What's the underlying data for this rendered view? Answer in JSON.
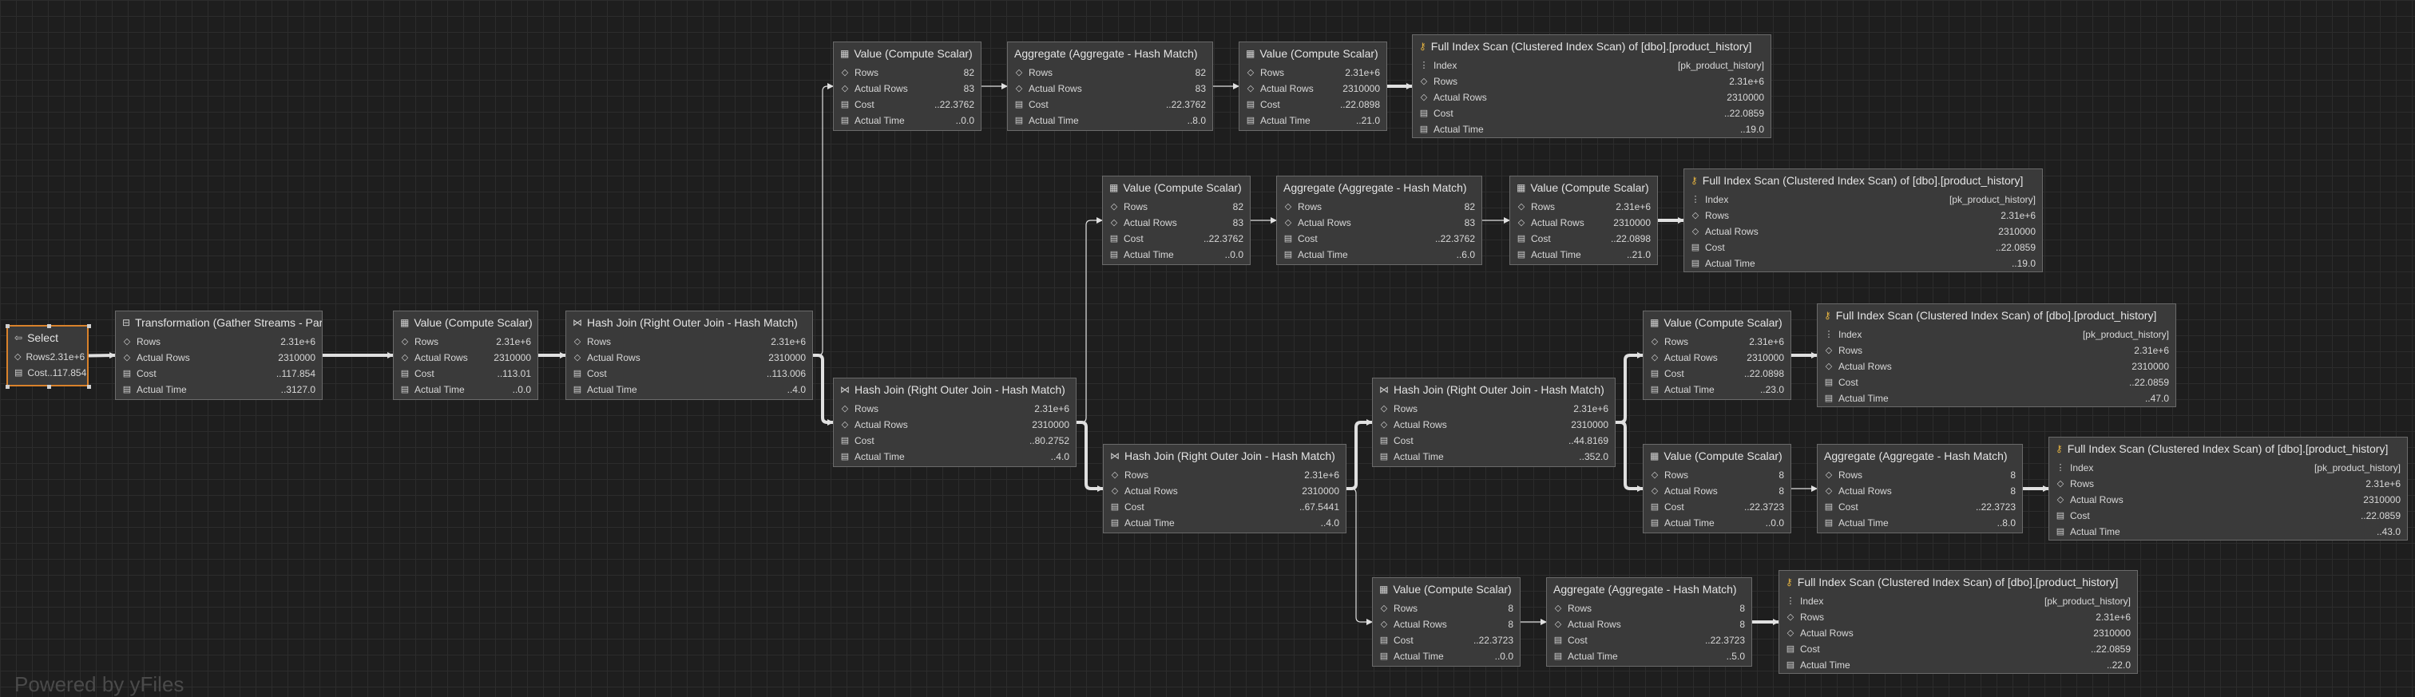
{
  "watermark": "Powered by yFiles",
  "nodes": [
    {
      "id": "select",
      "title": "Select",
      "icon": "select-icon",
      "rows": [
        {
          "icon": "rows-icon",
          "label": "Rows",
          "value": "2.31e+6"
        },
        {
          "icon": "cost-icon",
          "label": "Cost",
          "value": "..117.854"
        }
      ]
    },
    {
      "id": "gather",
      "title": "Transformation (Gather Streams - Parallelism)",
      "icon": "transform-icon",
      "rows": [
        {
          "icon": "rows-icon",
          "label": "Rows",
          "value": "2.31e+6"
        },
        {
          "icon": "actual-rows-icon",
          "label": "Actual Rows",
          "value": "2310000"
        },
        {
          "icon": "cost-icon",
          "label": "Cost",
          "value": "..117.854"
        },
        {
          "icon": "time-icon",
          "label": "Actual Time",
          "value": "..3127.0"
        }
      ]
    },
    {
      "id": "cs1",
      "title": "Value (Compute Scalar)",
      "icon": "table-icon",
      "rows": [
        {
          "icon": "rows-icon",
          "label": "Rows",
          "value": "2.31e+6"
        },
        {
          "icon": "actual-rows-icon",
          "label": "Actual Rows",
          "value": "2310000"
        },
        {
          "icon": "cost-icon",
          "label": "Cost",
          "value": "..113.01"
        },
        {
          "icon": "time-icon",
          "label": "Actual Time",
          "value": "..0.0"
        }
      ]
    },
    {
      "id": "hj1",
      "title": "Hash Join (Right Outer Join - Hash Match)",
      "icon": "join-icon",
      "rows": [
        {
          "icon": "rows-icon",
          "label": "Rows",
          "value": "2.31e+6"
        },
        {
          "icon": "actual-rows-icon",
          "label": "Actual Rows",
          "value": "2310000"
        },
        {
          "icon": "cost-icon",
          "label": "Cost",
          "value": "..113.006"
        },
        {
          "icon": "time-icon",
          "label": "Actual Time",
          "value": "..4.0"
        }
      ]
    },
    {
      "id": "cs_a1",
      "title": "Value (Compute Scalar)",
      "icon": "table-icon",
      "rows": [
        {
          "icon": "rows-icon",
          "label": "Rows",
          "value": "82"
        },
        {
          "icon": "actual-rows-icon",
          "label": "Actual Rows",
          "value": "83"
        },
        {
          "icon": "cost-icon",
          "label": "Cost",
          "value": "..22.3762"
        },
        {
          "icon": "time-icon",
          "label": "Actual Time",
          "value": "..0.0"
        }
      ]
    },
    {
      "id": "agg_a",
      "title": "Aggregate (Aggregate - Hash Match)",
      "icon": "none",
      "rows": [
        {
          "icon": "rows-icon",
          "label": "Rows",
          "value": "82"
        },
        {
          "icon": "actual-rows-icon",
          "label": "Actual Rows",
          "value": "83"
        },
        {
          "icon": "cost-icon",
          "label": "Cost",
          "value": "..22.3762"
        },
        {
          "icon": "time-icon",
          "label": "Actual Time",
          "value": "..8.0"
        }
      ]
    },
    {
      "id": "cs_a2",
      "title": "Value (Compute Scalar)",
      "icon": "table-icon",
      "rows": [
        {
          "icon": "rows-icon",
          "label": "Rows",
          "value": "2.31e+6"
        },
        {
          "icon": "actual-rows-icon",
          "label": "Actual Rows",
          "value": "2310000"
        },
        {
          "icon": "cost-icon",
          "label": "Cost",
          "value": "..22.0898"
        },
        {
          "icon": "time-icon",
          "label": "Actual Time",
          "value": "..21.0"
        }
      ]
    },
    {
      "id": "scan_a",
      "title": "Full Index Scan (Clustered Index Scan) of [dbo].[product_history]",
      "icon": "key-icon",
      "rows": [
        {
          "icon": "index-icon",
          "label": "Index",
          "value": "[pk_product_history]"
        },
        {
          "icon": "rows-icon",
          "label": "Rows",
          "value": "2.31e+6"
        },
        {
          "icon": "actual-rows-icon",
          "label": "Actual Rows",
          "value": "2310000"
        },
        {
          "icon": "cost-icon",
          "label": "Cost",
          "value": "..22.0859"
        },
        {
          "icon": "time-icon",
          "label": "Actual Time",
          "value": "..19.0"
        }
      ]
    },
    {
      "id": "cs_b1",
      "title": "Value (Compute Scalar)",
      "icon": "table-icon",
      "rows": [
        {
          "icon": "rows-icon",
          "label": "Rows",
          "value": "82"
        },
        {
          "icon": "actual-rows-icon",
          "label": "Actual Rows",
          "value": "83"
        },
        {
          "icon": "cost-icon",
          "label": "Cost",
          "value": "..22.3762"
        },
        {
          "icon": "time-icon",
          "label": "Actual Time",
          "value": "..0.0"
        }
      ]
    },
    {
      "id": "agg_b",
      "title": "Aggregate (Aggregate - Hash Match)",
      "icon": "none",
      "rows": [
        {
          "icon": "rows-icon",
          "label": "Rows",
          "value": "82"
        },
        {
          "icon": "actual-rows-icon",
          "label": "Actual Rows",
          "value": "83"
        },
        {
          "icon": "cost-icon",
          "label": "Cost",
          "value": "..22.3762"
        },
        {
          "icon": "time-icon",
          "label": "Actual Time",
          "value": "..6.0"
        }
      ]
    },
    {
      "id": "cs_b2",
      "title": "Value (Compute Scalar)",
      "icon": "table-icon",
      "rows": [
        {
          "icon": "rows-icon",
          "label": "Rows",
          "value": "2.31e+6"
        },
        {
          "icon": "actual-rows-icon",
          "label": "Actual Rows",
          "value": "2310000"
        },
        {
          "icon": "cost-icon",
          "label": "Cost",
          "value": "..22.0898"
        },
        {
          "icon": "time-icon",
          "label": "Actual Time",
          "value": "..21.0"
        }
      ]
    },
    {
      "id": "scan_b",
      "title": "Full Index Scan (Clustered Index Scan) of [dbo].[product_history]",
      "icon": "key-icon",
      "rows": [
        {
          "icon": "index-icon",
          "label": "Index",
          "value": "[pk_product_history]"
        },
        {
          "icon": "rows-icon",
          "label": "Rows",
          "value": "2.31e+6"
        },
        {
          "icon": "actual-rows-icon",
          "label": "Actual Rows",
          "value": "2310000"
        },
        {
          "icon": "cost-icon",
          "label": "Cost",
          "value": "..22.0859"
        },
        {
          "icon": "time-icon",
          "label": "Actual Time",
          "value": "..19.0"
        }
      ]
    },
    {
      "id": "hj2",
      "title": "Hash Join (Right Outer Join - Hash Match)",
      "icon": "join-icon",
      "rows": [
        {
          "icon": "rows-icon",
          "label": "Rows",
          "value": "2.31e+6"
        },
        {
          "icon": "actual-rows-icon",
          "label": "Actual Rows",
          "value": "2310000"
        },
        {
          "icon": "cost-icon",
          "label": "Cost",
          "value": "..80.2752"
        },
        {
          "icon": "time-icon",
          "label": "Actual Time",
          "value": "..4.0"
        }
      ]
    },
    {
      "id": "hj3",
      "title": "Hash Join (Right Outer Join - Hash Match)",
      "icon": "join-icon",
      "rows": [
        {
          "icon": "rows-icon",
          "label": "Rows",
          "value": "2.31e+6"
        },
        {
          "icon": "actual-rows-icon",
          "label": "Actual Rows",
          "value": "2310000"
        },
        {
          "icon": "cost-icon",
          "label": "Cost",
          "value": "..67.5441"
        },
        {
          "icon": "time-icon",
          "label": "Actual Time",
          "value": "..4.0"
        }
      ]
    },
    {
      "id": "hj4",
      "title": "Hash Join (Right Outer Join - Hash Match)",
      "icon": "join-icon",
      "rows": [
        {
          "icon": "rows-icon",
          "label": "Rows",
          "value": "2.31e+6"
        },
        {
          "icon": "actual-rows-icon",
          "label": "Actual Rows",
          "value": "2310000"
        },
        {
          "icon": "cost-icon",
          "label": "Cost",
          "value": "..44.8169"
        },
        {
          "icon": "time-icon",
          "label": "Actual Time",
          "value": "..352.0"
        }
      ]
    },
    {
      "id": "cs_c",
      "title": "Value (Compute Scalar)",
      "icon": "table-icon",
      "rows": [
        {
          "icon": "rows-icon",
          "label": "Rows",
          "value": "2.31e+6"
        },
        {
          "icon": "actual-rows-icon",
          "label": "Actual Rows",
          "value": "2310000"
        },
        {
          "icon": "cost-icon",
          "label": "Cost",
          "value": "..22.0898"
        },
        {
          "icon": "time-icon",
          "label": "Actual Time",
          "value": "..23.0"
        }
      ]
    },
    {
      "id": "scan_c",
      "title": "Full Index Scan (Clustered Index Scan) of [dbo].[product_history]",
      "icon": "key-icon",
      "rows": [
        {
          "icon": "index-icon",
          "label": "Index",
          "value": "[pk_product_history]"
        },
        {
          "icon": "rows-icon",
          "label": "Rows",
          "value": "2.31e+6"
        },
        {
          "icon": "actual-rows-icon",
          "label": "Actual Rows",
          "value": "2310000"
        },
        {
          "icon": "cost-icon",
          "label": "Cost",
          "value": "..22.0859"
        },
        {
          "icon": "time-icon",
          "label": "Actual Time",
          "value": "..47.0"
        }
      ]
    },
    {
      "id": "cs_d",
      "title": "Value (Compute Scalar)",
      "icon": "table-icon",
      "rows": [
        {
          "icon": "rows-icon",
          "label": "Rows",
          "value": "8"
        },
        {
          "icon": "actual-rows-icon",
          "label": "Actual Rows",
          "value": "8"
        },
        {
          "icon": "cost-icon",
          "label": "Cost",
          "value": "..22.3723"
        },
        {
          "icon": "time-icon",
          "label": "Actual Time",
          "value": "..0.0"
        }
      ]
    },
    {
      "id": "agg_d",
      "title": "Aggregate (Aggregate - Hash Match)",
      "icon": "none",
      "rows": [
        {
          "icon": "rows-icon",
          "label": "Rows",
          "value": "8"
        },
        {
          "icon": "actual-rows-icon",
          "label": "Actual Rows",
          "value": "8"
        },
        {
          "icon": "cost-icon",
          "label": "Cost",
          "value": "..22.3723"
        },
        {
          "icon": "time-icon",
          "label": "Actual Time",
          "value": "..8.0"
        }
      ]
    },
    {
      "id": "scan_d",
      "title": "Full Index Scan (Clustered Index Scan) of [dbo].[product_history]",
      "icon": "key-icon",
      "rows": [
        {
          "icon": "index-icon",
          "label": "Index",
          "value": "[pk_product_history]"
        },
        {
          "icon": "rows-icon",
          "label": "Rows",
          "value": "2.31e+6"
        },
        {
          "icon": "actual-rows-icon",
          "label": "Actual Rows",
          "value": "2310000"
        },
        {
          "icon": "cost-icon",
          "label": "Cost",
          "value": "..22.0859"
        },
        {
          "icon": "time-icon",
          "label": "Actual Time",
          "value": "..43.0"
        }
      ]
    },
    {
      "id": "cs_e",
      "title": "Value (Compute Scalar)",
      "icon": "table-icon",
      "rows": [
        {
          "icon": "rows-icon",
          "label": "Rows",
          "value": "8"
        },
        {
          "icon": "actual-rows-icon",
          "label": "Actual Rows",
          "value": "8"
        },
        {
          "icon": "cost-icon",
          "label": "Cost",
          "value": "..22.3723"
        },
        {
          "icon": "time-icon",
          "label": "Actual Time",
          "value": "..0.0"
        }
      ]
    },
    {
      "id": "agg_e",
      "title": "Aggregate (Aggregate - Hash Match)",
      "icon": "none",
      "rows": [
        {
          "icon": "rows-icon",
          "label": "Rows",
          "value": "8"
        },
        {
          "icon": "actual-rows-icon",
          "label": "Actual Rows",
          "value": "8"
        },
        {
          "icon": "cost-icon",
          "label": "Cost",
          "value": "..22.3723"
        },
        {
          "icon": "time-icon",
          "label": "Actual Time",
          "value": "..5.0"
        }
      ]
    },
    {
      "id": "scan_e",
      "title": "Full Index Scan (Clustered Index Scan) of [dbo].[product_history]",
      "icon": "key-icon",
      "rows": [
        {
          "icon": "index-icon",
          "label": "Index",
          "value": "[pk_product_history]"
        },
        {
          "icon": "rows-icon",
          "label": "Rows",
          "value": "2.31e+6"
        },
        {
          "icon": "actual-rows-icon",
          "label": "Actual Rows",
          "value": "2310000"
        },
        {
          "icon": "cost-icon",
          "label": "Cost",
          "value": "..22.0859"
        },
        {
          "icon": "time-icon",
          "label": "Actual Time",
          "value": "..22.0"
        }
      ]
    }
  ],
  "edges": [
    {
      "from": "select",
      "to": "gather",
      "weight": "heavy"
    },
    {
      "from": "gather",
      "to": "cs1",
      "weight": "heavy"
    },
    {
      "from": "cs1",
      "to": "hj1",
      "weight": "heavy"
    },
    {
      "from": "hj1",
      "to": "cs_a1",
      "weight": "light"
    },
    {
      "from": "hj1",
      "to": "hj2",
      "weight": "heavy"
    },
    {
      "from": "cs_a1",
      "to": "agg_a",
      "weight": "light"
    },
    {
      "from": "agg_a",
      "to": "cs_a2",
      "weight": "light"
    },
    {
      "from": "cs_a2",
      "to": "scan_a",
      "weight": "heavy"
    },
    {
      "from": "hj2",
      "to": "cs_b1",
      "weight": "light"
    },
    {
      "from": "hj2",
      "to": "hj3",
      "weight": "heavy"
    },
    {
      "from": "cs_b1",
      "to": "agg_b",
      "weight": "light"
    },
    {
      "from": "agg_b",
      "to": "cs_b2",
      "weight": "light"
    },
    {
      "from": "cs_b2",
      "to": "scan_b",
      "weight": "heavy"
    },
    {
      "from": "hj3",
      "to": "hj4",
      "weight": "heavy"
    },
    {
      "from": "hj3",
      "to": "cs_e",
      "weight": "light"
    },
    {
      "from": "hj4",
      "to": "cs_c",
      "weight": "heavy"
    },
    {
      "from": "hj4",
      "to": "cs_d",
      "weight": "heavy"
    },
    {
      "from": "cs_c",
      "to": "scan_c",
      "weight": "heavy"
    },
    {
      "from": "cs_d",
      "to": "agg_d",
      "weight": "light"
    },
    {
      "from": "agg_d",
      "to": "scan_d",
      "weight": "heavy"
    },
    {
      "from": "cs_e",
      "to": "agg_e",
      "weight": "light"
    },
    {
      "from": "agg_e",
      "to": "scan_e",
      "weight": "heavy"
    }
  ],
  "colors": {
    "background": "#1e1e1e",
    "node": "#3a3a3a",
    "border": "#6a6a6a",
    "selected": "#d9822b",
    "edge": "#e0e0e0",
    "key": "#e0b040"
  }
}
